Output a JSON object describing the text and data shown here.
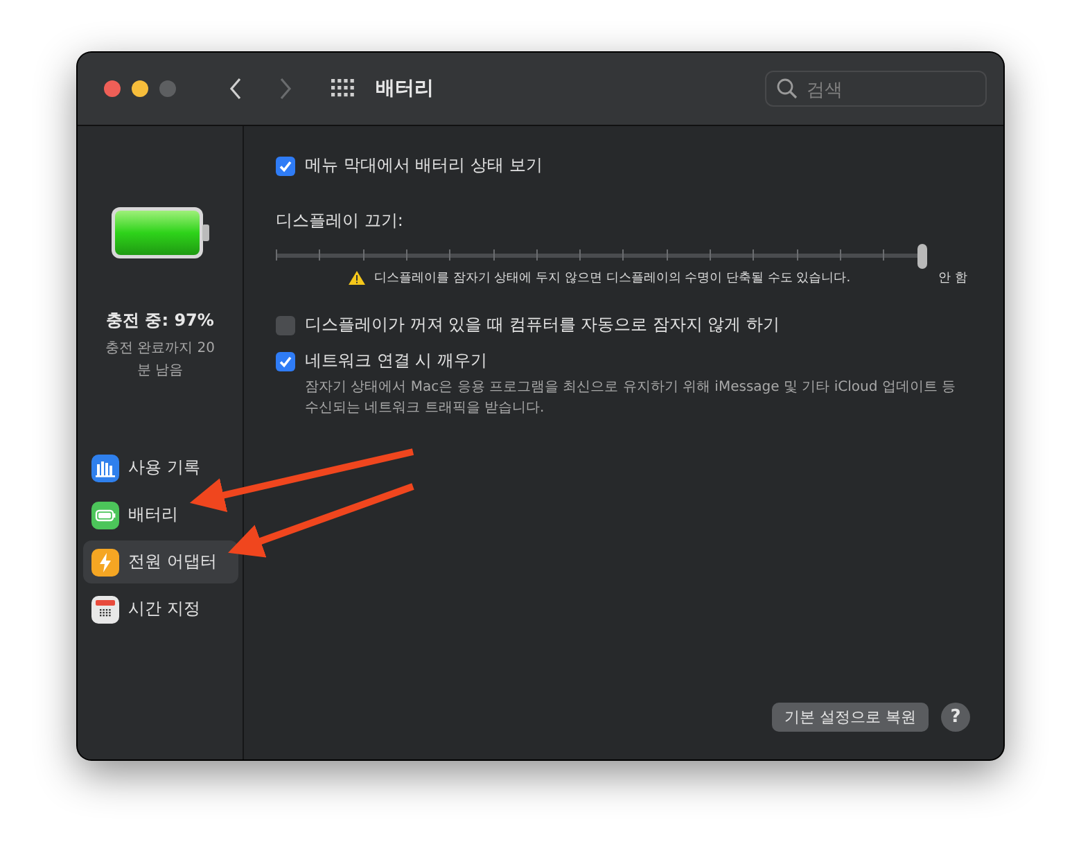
{
  "window": {
    "title": "배터리"
  },
  "search": {
    "placeholder": "검색"
  },
  "sidebar": {
    "status": "충전 중: 97%",
    "remaining": "충전 완료까지 20 분 남음",
    "items": [
      {
        "label": "사용 기록",
        "kind": "usage",
        "selected": false
      },
      {
        "label": "배터리",
        "kind": "battery",
        "selected": false
      },
      {
        "label": "전원 어댑터",
        "kind": "adapter",
        "selected": true
      },
      {
        "label": "시간 지정",
        "kind": "schedule",
        "selected": false
      }
    ]
  },
  "options": [
    {
      "kind": "checkbox",
      "label": "메뉴 막대에서 배터리 상태 보기",
      "checked": true
    },
    {
      "kind": "slider",
      "label": "디스플레이 끄기:",
      "level": 1,
      "warning": "디스플레이를 잠자기 상태에 두지 않으면 디스플레이의 수명이 단축될 수도 있습니다.",
      "end_label": "안 함"
    },
    {
      "kind": "checkbox",
      "label": "디스플레이가 꺼져 있을 때 컴퓨터를 자동으로 잠자지 않게 하기",
      "checked": false
    },
    {
      "kind": "checkbox",
      "label": "네트워크 연결 시 깨우기",
      "checked": true,
      "description": "잠자기 상태에서 Mac은 응용 프로그램을 최신으로 유지하기 위해 iMessage 및 기타 iCloud 업데이트 등 수신되는 네트워크 트래픽을 받습니다."
    }
  ],
  "buttons": {
    "restore": "기본 설정으로 복원",
    "help": "?"
  }
}
